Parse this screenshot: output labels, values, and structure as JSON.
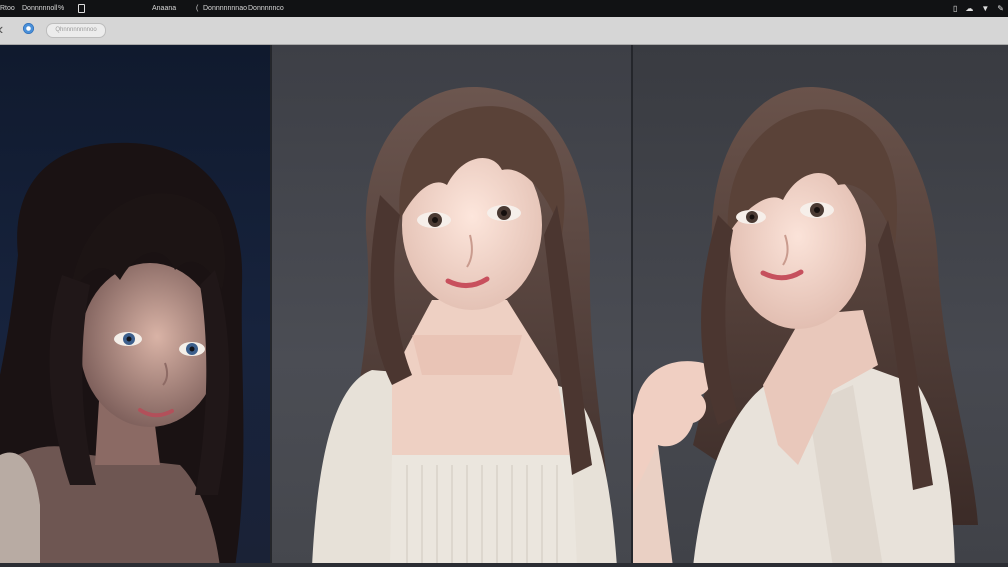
{
  "topbar": {
    "app_short": "Rtoo",
    "menu_a": "Donnnnnoll",
    "pct": "%",
    "title": "Anaana",
    "tab_a": "Donnnnnnnao",
    "tab_b": "Donnnnnco"
  },
  "toolbar": {
    "back_glyph": "‹",
    "address_text": "Qhnnnnnnnnoo"
  },
  "photos": [
    {
      "alt": "portrait-blue-background"
    },
    {
      "alt": "portrait-gray-background-front"
    },
    {
      "alt": "portrait-gray-background-side"
    }
  ],
  "colors": {
    "panel1_bg": "#17233d",
    "panel2_bg": "#4b4d54",
    "panel3_bg": "#474950",
    "hair": "#5a4238",
    "hair_dark": "#1c1414",
    "skin": "#f1d2c6",
    "blouse": "#e9e4dc"
  }
}
